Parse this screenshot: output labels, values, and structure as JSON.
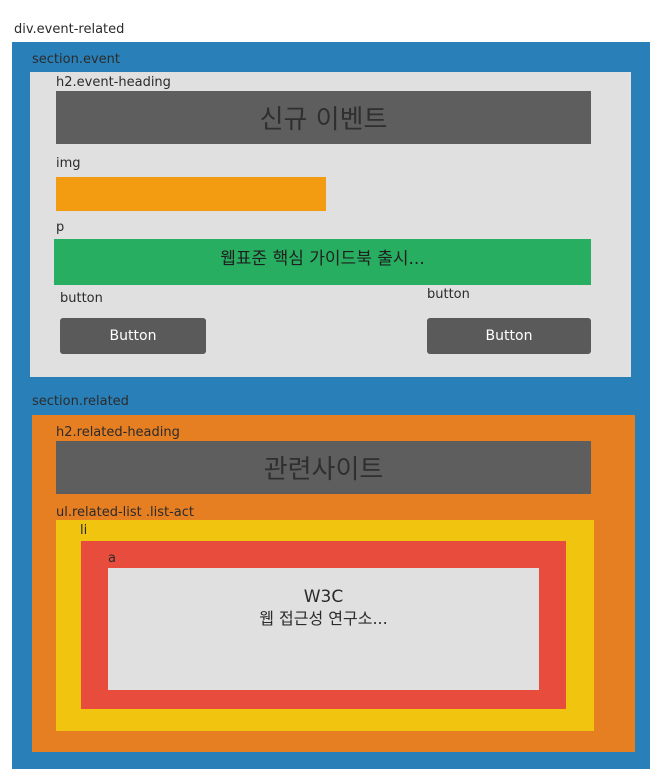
{
  "labels": {
    "outer": "div.event-related",
    "section_event": "section.event",
    "event_heading": "h2.event-heading",
    "img": "img",
    "p": "p",
    "button_left": "button",
    "button_right": "button",
    "section_related": "section.related",
    "related_heading": "h2.related-heading",
    "ul": "ul.related-list  .list-act",
    "li": "li",
    "a": "a"
  },
  "event": {
    "heading": "신규 이벤트",
    "paragraph": "웹표준 핵심 가이드북 출시...",
    "button_left": "Button",
    "button_right": "Button"
  },
  "related": {
    "heading": "관련사이트",
    "link_title": "W3C",
    "link_desc": "웹 접근성 연구소..."
  },
  "colors": {
    "outer": "#2980b9",
    "event_bg": "#e0e0e0",
    "heading_bg": "#5e5e5e",
    "img": "#f39c12",
    "p": "#27ae60",
    "button": "#5a5a5a",
    "related_bg": "#e67e22",
    "ul": "#f1c40f",
    "li": "#e74c3c",
    "a": "#e0e0e0"
  }
}
